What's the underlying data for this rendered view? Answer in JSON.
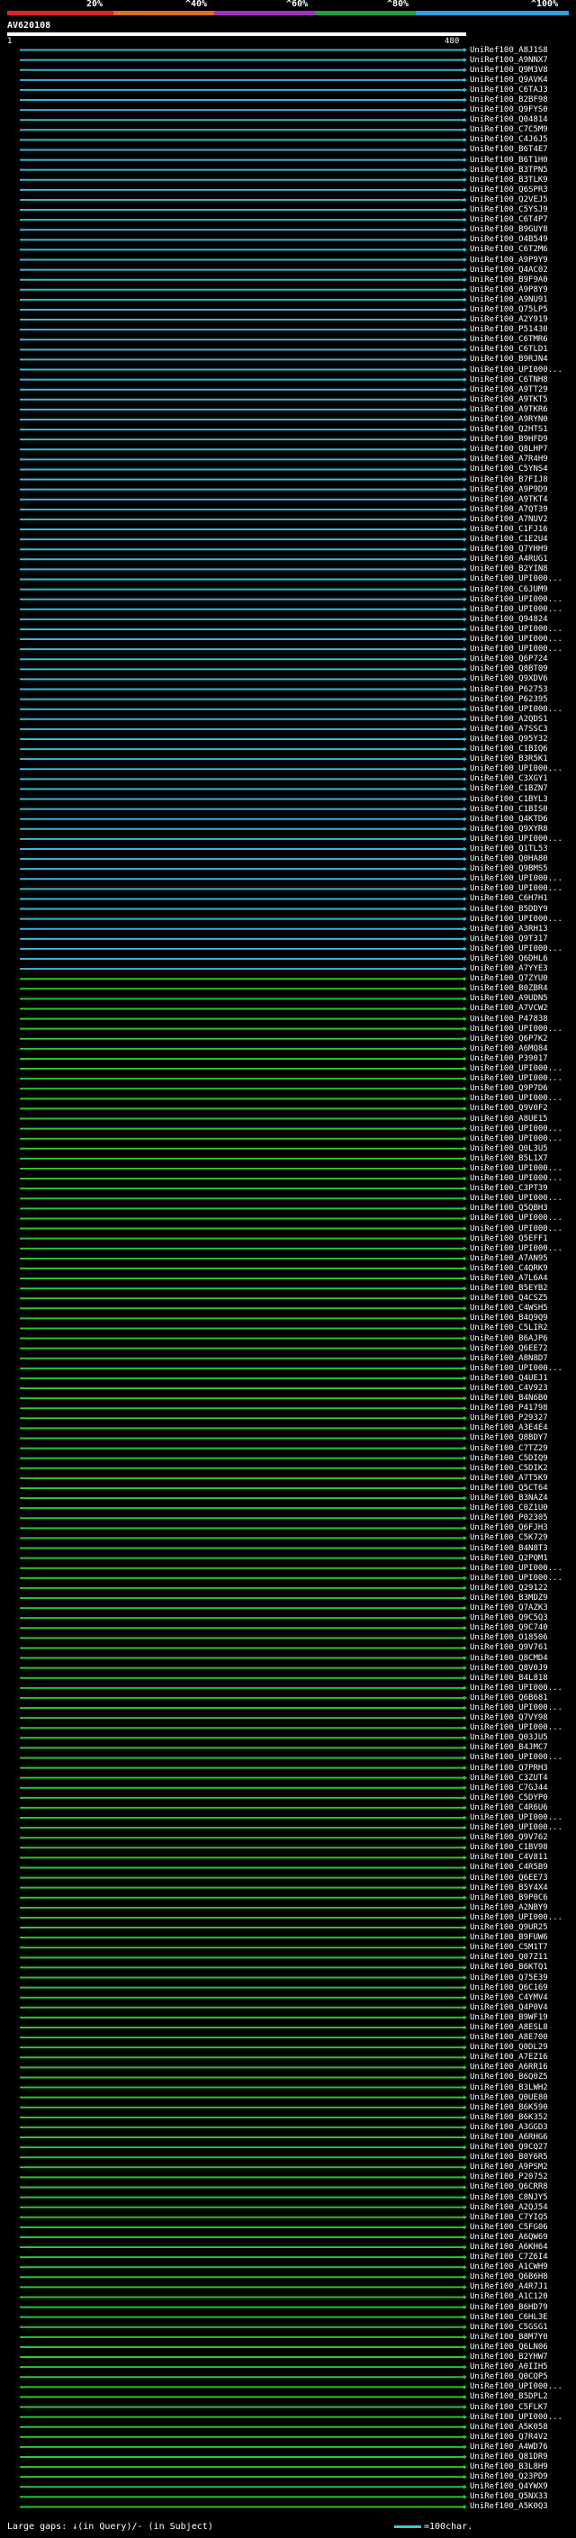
{
  "scale": {
    "labels": [
      "20%",
      "^40%",
      "^60%",
      "^80%",
      "^100%"
    ],
    "bands": [
      {
        "color": "#e0202a"
      },
      {
        "color": "#e07020"
      },
      {
        "color": "#a030c0"
      },
      {
        "color": "#20a040"
      },
      {
        "color": "#30a0e0"
      }
    ]
  },
  "query": {
    "name": "AV620108",
    "start": "1",
    "end": "480"
  },
  "colors": {
    "blue": "#33cccc",
    "green": "#2bc42b",
    "bar_blue": "#3ab7d8"
  },
  "hits": [
    "UniRef100_A8J1S8",
    "UniRef100_A9NNX7",
    "UniRef100_Q9M3V8",
    "UniRef100_Q9AVK4",
    "UniRef100_C6TAJ3",
    "UniRef100_B2BF98",
    "UniRef100_Q9FYS0",
    "UniRef100_Q04814",
    "UniRef100_C7C5M9",
    "UniRef100_C4J6J5",
    "UniRef100_B6T4E7",
    "UniRef100_B6T1H0",
    "UniRef100_B3TPN5",
    "UniRef100_B3TLK9",
    "UniRef100_Q6SPR3",
    "UniRef100_Q2VEJ5",
    "UniRef100_C5YSJ9",
    "UniRef100_C6T4P7",
    "UniRef100_B9GUY8",
    "UniRef100_O4B549",
    "UniRef100_C6T2M6",
    "UniRef100_A9P9Y9",
    "UniRef100_Q4AC02",
    "UniRef100_B9F9A0",
    "UniRef100_A9P8Y9",
    "UniRef100_A9NU91",
    "UniRef100_Q75LP5",
    "UniRef100_A2Y919",
    "UniRef100_P51430",
    "UniRef100_C6TMR6",
    "UniRef100_C6TLD1",
    "UniRef100_B9RJN4",
    "UniRef100_UPI000...",
    "UniRef100_C6TNH8",
    "UniRef100_A9TT29",
    "UniRef100_A9TKT5",
    "UniRef100_A9TKR6",
    "UniRef100_A9RYN0",
    "UniRef100_Q2HTS1",
    "UniRef100_B9HFD9",
    "UniRef100_Q8LHP7",
    "UniRef100_A7R4H9",
    "UniRef100_C5YNS4",
    "UniRef100_B7FIJ8",
    "UniRef100_A9P9D9",
    "UniRef100_A9TKT4",
    "UniRef100_A7QT39",
    "UniRef100_A7NUV2",
    "UniRef100_C1FJ16",
    "UniRef100_C1E2U4",
    "UniRef100_Q7YHH9",
    "UniRef100_A4RUG1",
    "UniRef100_B2YIN8",
    "UniRef100_UPI000...",
    "UniRef100_C6JUM9",
    "UniRef100_UPI000...",
    "UniRef100_UPI000...",
    "UniRef100_Q94824",
    "UniRef100_UPI000...",
    "UniRef100_UPI000...",
    "UniRef100_UPI000...",
    "UniRef100_Q6P724",
    "UniRef100_Q8BT09",
    "UniRef100_Q9XDV6",
    "UniRef100_P62753",
    "UniRef100_P62395",
    "UniRef100_UPI000...",
    "UniRef100_A2QDS1",
    "UniRef100_A7SSC3",
    "UniRef100_Q95Y32",
    "UniRef100_C1BIQ6",
    "UniRef100_B3R5K1",
    "UniRef100_UPI000...",
    "UniRef100_C3XGY1",
    "UniRef100_C1BZN7",
    "UniRef100_C1BYL3",
    "UniRef100_C1BIS0",
    "UniRef100_Q4KTD6",
    "UniRef100_Q9XYR8",
    "UniRef100_UPI000...",
    "UniRef100_Q1TL53",
    "UniRef100_Q0HA80",
    "UniRef100_Q9BMS5",
    "UniRef100_UPI000...",
    "UniRef100_UPI000...",
    "UniRef100_C6H7H1",
    "UniRef100_B5DDY9",
    "UniRef100_UPI000...",
    "UniRef100_A3RH13",
    "UniRef100_Q9T317",
    "UniRef100_UPI000...",
    "UniRef100_Q6DHL6",
    "UniRef100_A7YYE3",
    "UniRef100_Q7ZYU0",
    "UniRef100_B0ZBR4",
    "UniRef100_A9UDN5",
    "UniRef100_A7VCW2",
    "UniRef100_P47838",
    "UniRef100_UPI000...",
    "UniRef100_Q6P7K2",
    "UniRef100_A6MQ84",
    "UniRef100_P39017",
    "UniRef100_UPI000...",
    "UniRef100_UPI000...",
    "UniRef100_Q9P7D6",
    "UniRef100_UPI000...",
    "UniRef100_Q9V0F2",
    "UniRef100_A8UE15",
    "UniRef100_UPI000...",
    "UniRef100_UPI000...",
    "UniRef100_Q0L3U5",
    "UniRef100_B5L1X7",
    "UniRef100_UPI000...",
    "UniRef100_UPI000...",
    "UniRef100_C3PT39",
    "UniRef100_UPI000...",
    "UniRef100_Q5QBH3",
    "UniRef100_UPI000...",
    "UniRef100_UPI000...",
    "UniRef100_Q5EFF1",
    "UniRef100_UPI000...",
    "UniRef100_A7AN95",
    "UniRef100_C4QRK9",
    "UniRef100_A7L6A4",
    "UniRef100_B5EYB2",
    "UniRef100_Q4CSZ5",
    "UniRef100_C4WSH5",
    "UniRef100_B4Q9Q9",
    "UniRef100_C5LIR2",
    "UniRef100_B6AJP6",
    "UniRef100_Q6EE72",
    "UniRef100_A8N8D7",
    "UniRef100_UPI000...",
    "UniRef100_Q4UEJ1",
    "UniRef100_C4V923",
    "UniRef100_B4N6B0",
    "UniRef100_P41798",
    "UniRef100_P29327",
    "UniRef100_A3E4E4",
    "UniRef100_Q8BDY7",
    "UniRef100_C7TZ29",
    "UniRef100_C5DIQ9",
    "UniRef100_C5DIK2",
    "UniRef100_A7T5K9",
    "UniRef100_Q5CT64",
    "UniRef100_B3NAZ4",
    "UniRef100_C0Z1U0",
    "UniRef100_P02305",
    "UniRef100_Q6FJH3",
    "UniRef100_C5K729",
    "UniRef100_B4N8T3",
    "UniRef100_Q2PQM1",
    "UniRef100_UPI000...",
    "UniRef100_UPI000...",
    "UniRef100_Q29122",
    "UniRef100_B3MDZ9",
    "UniRef100_Q7AZK3",
    "UniRef100_Q9C5Q3",
    "UniRef100_Q9C740",
    "UniRef100_O18506",
    "UniRef100_Q9V761",
    "UniRef100_Q8CMD4",
    "UniRef100_Q8V0J9",
    "UniRef100_B4L818",
    "UniRef100_UPI000...",
    "UniRef100_Q6B681",
    "UniRef100_UPI000...",
    "UniRef100_Q7VY98",
    "UniRef100_UPI000...",
    "UniRef100_Q03JU5",
    "UniRef100_B4JMC7",
    "UniRef100_UPI000...",
    "UniRef100_Q7PRH3",
    "UniRef100_C3ZUT4",
    "UniRef100_C7GJ44",
    "UniRef100_C5DYP0",
    "UniRef100_C4R6U6",
    "UniRef100_UPI000...",
    "UniRef100_UPI000...",
    "UniRef100_Q9V762",
    "UniRef100_C1BV98",
    "UniRef100_C4V811",
    "UniRef100_C4R5B9",
    "UniRef100_Q6EE73",
    "UniRef100_B5Y4X4",
    "UniRef100_B9P0C6",
    "UniRef100_A2NBY9",
    "UniRef100_UPI000...",
    "UniRef100_Q9UR25",
    "UniRef100_B9FUW6",
    "UniRef100_C5M1T7",
    "UniRef100_Q07Z11",
    "UniRef100_B6KTQ1",
    "UniRef100_Q75E39",
    "UniRef100_Q6C169",
    "UniRef100_C4YMV4",
    "UniRef100_Q4P0V4",
    "UniRef100_B9WF19",
    "UniRef100_A8ESL8",
    "UniRef100_A8E700",
    "UniRef100_Q0DL29",
    "UniRef100_A7EZ16",
    "UniRef100_A6RR16",
    "UniRef100_B6Q0Z5",
    "UniRef100_B3LWH2",
    "UniRef100_Q0UE80",
    "UniRef100_B6K590",
    "UniRef100_B6K352",
    "UniRef100_A3GGD3",
    "UniRef100_A6RHG6",
    "UniRef100_Q9CQ27",
    "UniRef100_B0Y6R5",
    "UniRef100_A9PSM2",
    "UniRef100_P20752",
    "UniRef100_Q6CRR8",
    "UniRef100_C8NJY5",
    "UniRef100_A2QJ54",
    "UniRef100_C7YIQ5",
    "UniRef100_C5FG06",
    "UniRef100_A6QW69",
    "UniRef100_A6KH64",
    "UniRef100_C7Z6I4",
    "UniRef100_A1CWH9",
    "UniRef100_Q6B6H8",
    "UniRef100_A4R7J1",
    "UniRef100_A1C120",
    "UniRef100_B6HD79",
    "UniRef100_C6HL3E",
    "UniRef100_C5GSG1",
    "UniRef100_B8M7Y0",
    "UniRef100_Q6LN06",
    "UniRef100_B2YHW7",
    "UniRef100_A0IIH5",
    "UniRef100_Q0CQP5",
    "UniRef100_UPI000...",
    "UniRef100_B5DPL2",
    "UniRef100_C5FLK7",
    "UniRef100_UPI000...",
    "UniRef100_A5K058",
    "UniRef100_Q7R4V2",
    "UniRef100_A4WD76",
    "UniRef100_Q81DR9",
    "UniRef100_B3L8H9",
    "UniRef100_Q23PD9",
    "UniRef100_Q4YWX9",
    "UniRef100_Q5NX33",
    "UniRef100_A5K0Q3"
  ],
  "legend": {
    "left": "Large gaps: ↓(in Query)/- (in Subject)",
    "right": "=100char."
  }
}
